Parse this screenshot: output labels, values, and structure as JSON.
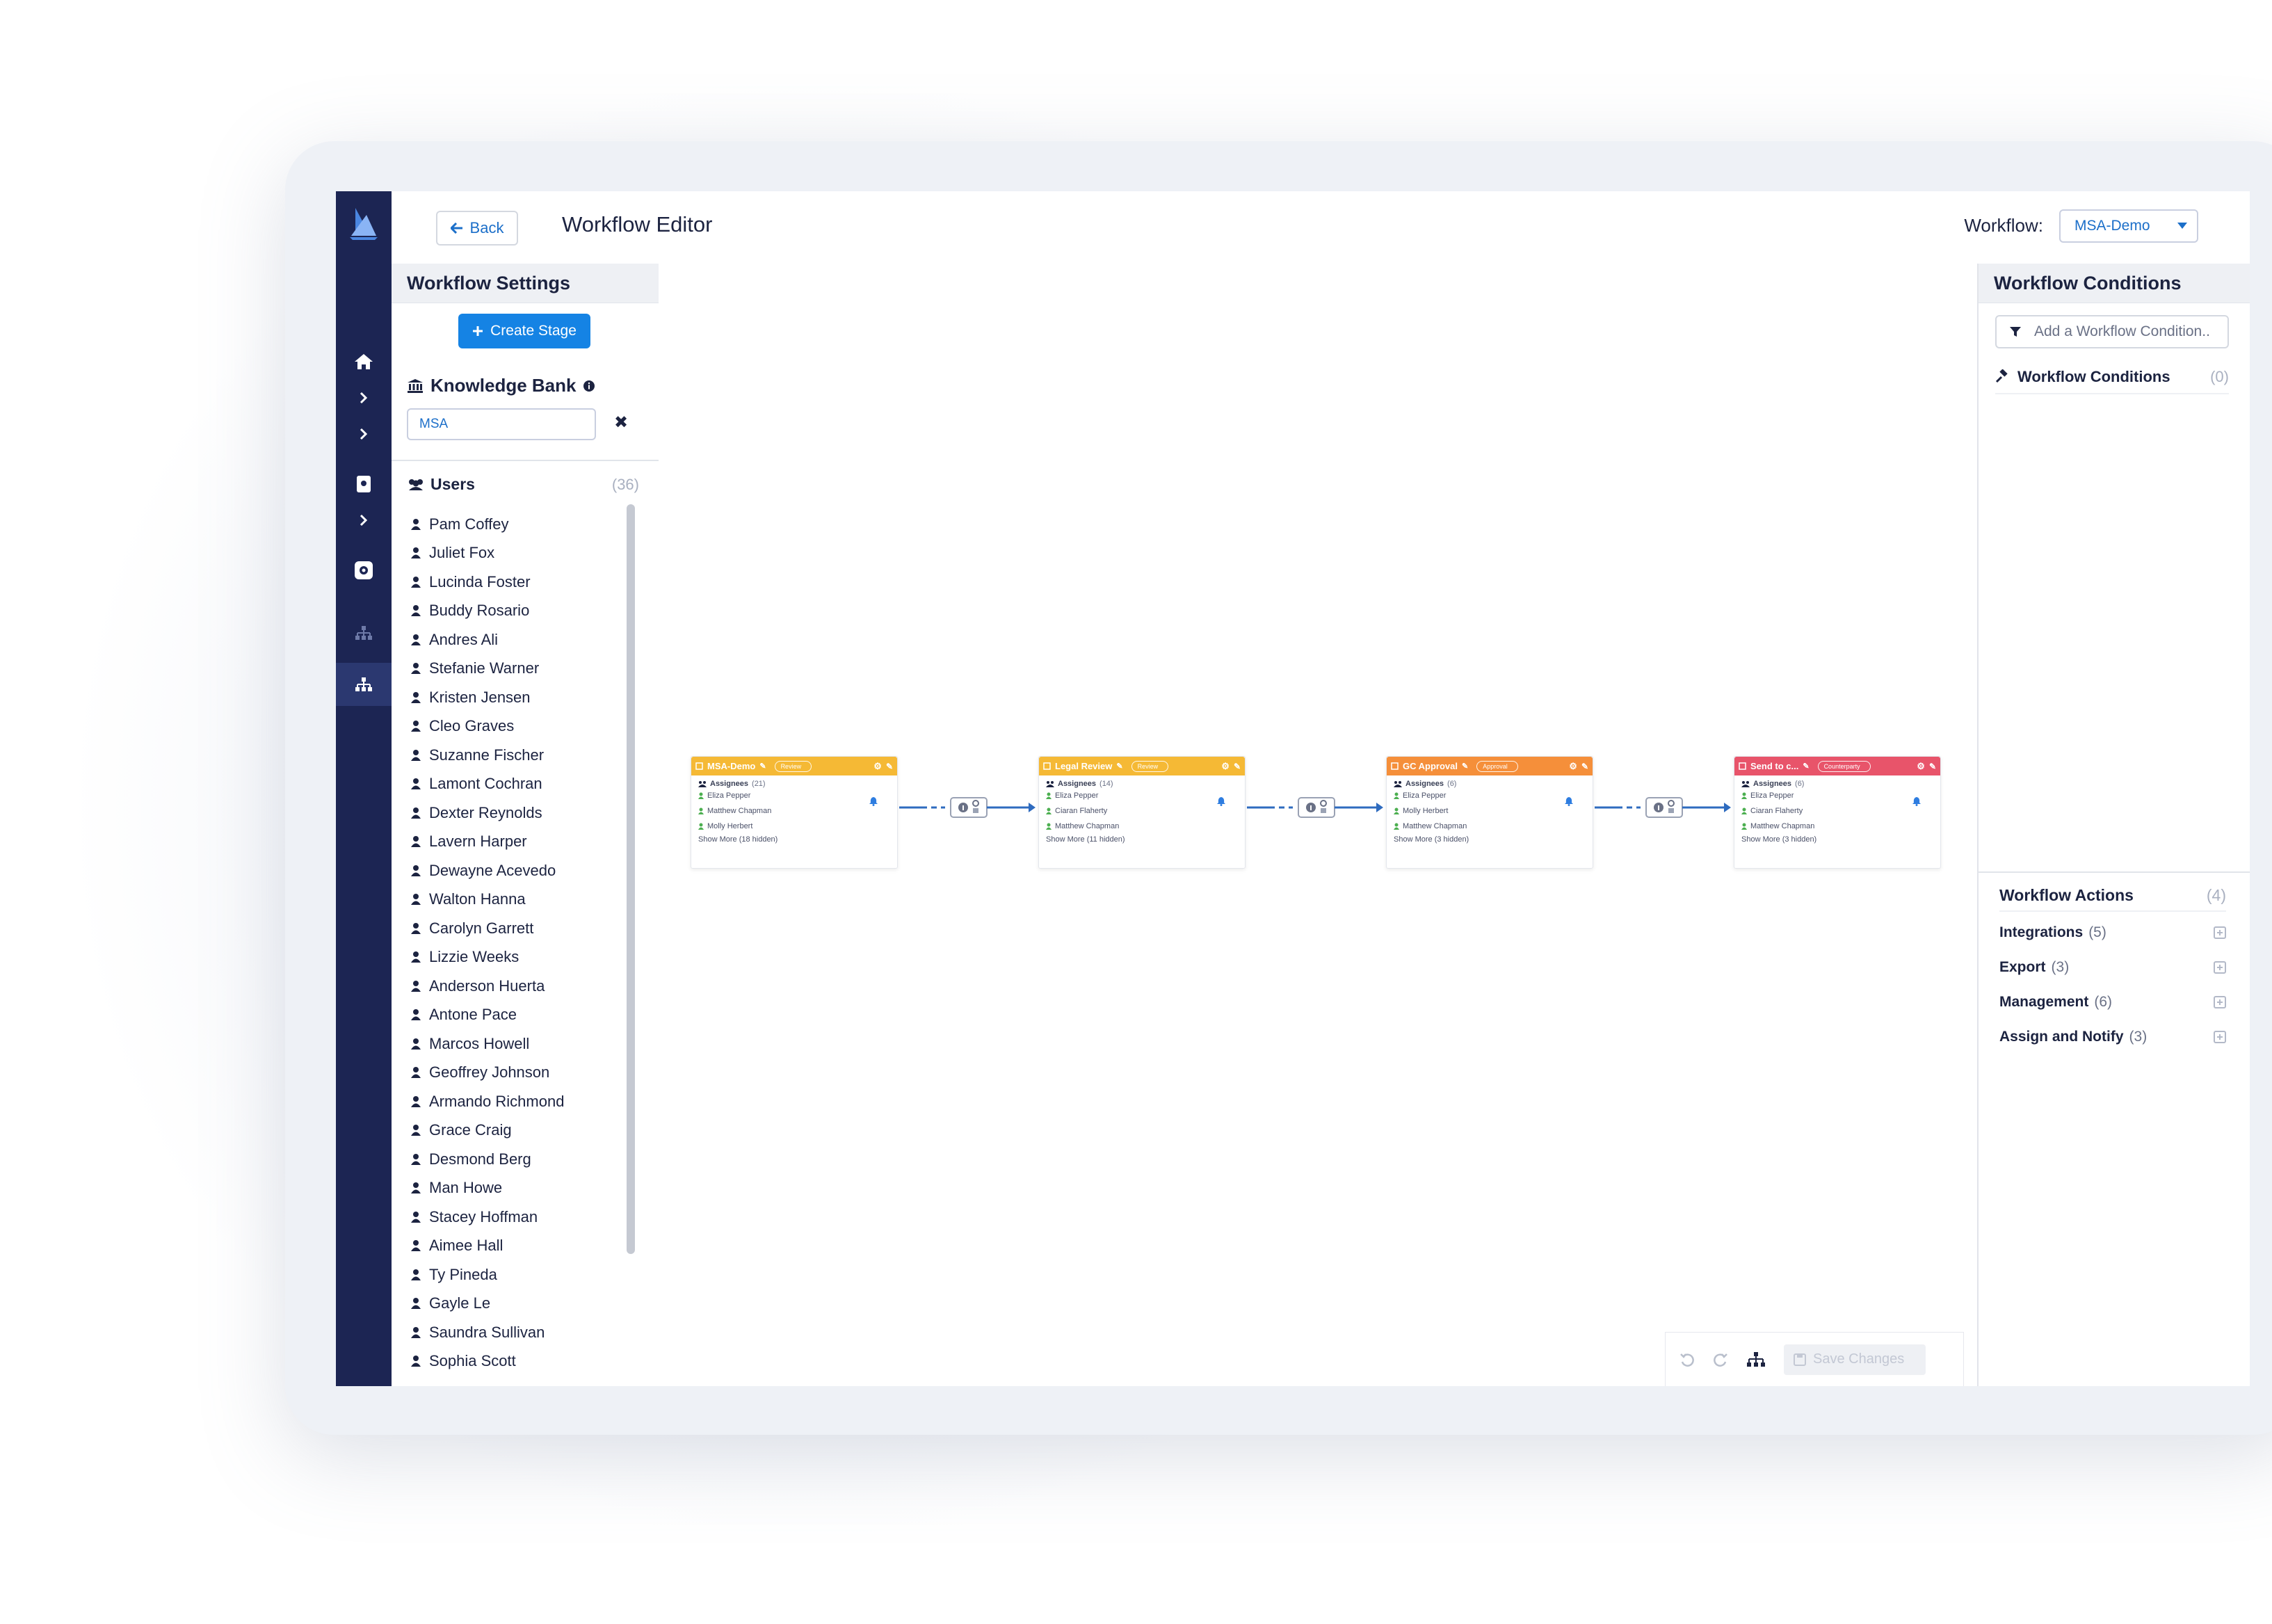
{
  "topbar": {
    "back_label": "Back",
    "title": "Workflow Editor",
    "workflow_label": "Workflow:",
    "workflow_value": "MSA-Demo"
  },
  "rail": {
    "icons": [
      "logo",
      "home-icon",
      "chevron-right-icon",
      "chevron-right-icon",
      "document-icon",
      "chevron-right-icon",
      "gear-icon",
      "workflow-icon",
      "workflow-icon"
    ]
  },
  "left_panel": {
    "title": "Workflow Settings",
    "create_stage_label": "Create Stage",
    "knowledge_bank_label": "Knowledge Bank",
    "knowledge_bank_value": "MSA",
    "users_label": "Users",
    "users_count": "(36)",
    "users": [
      "Pam Coffey",
      "Juliet Fox",
      "Lucinda Foster",
      "Buddy Rosario",
      "Andres Ali",
      "Stefanie Warner",
      "Kristen Jensen",
      "Cleo Graves",
      "Suzanne Fischer",
      "Lamont Cochran",
      "Dexter Reynolds",
      "Lavern Harper",
      "Dewayne Acevedo",
      "Walton Hanna",
      "Carolyn Garrett",
      "Lizzie Weeks",
      "Anderson Huerta",
      "Antone Pace",
      "Marcos Howell",
      "Geoffrey Johnson",
      "Armando Richmond",
      "Grace Craig",
      "Desmond Berg",
      "Man Howe",
      "Stacey Hoffman",
      "Aimee Hall",
      "Ty Pineda",
      "Gayle Le",
      "Saundra Sullivan",
      "Sophia Scott"
    ]
  },
  "right_panel": {
    "title": "Workflow Conditions",
    "add_condition_placeholder": "Add a Workflow Condition..",
    "conditions_label": "Workflow Conditions",
    "conditions_count": "(0)",
    "actions_label": "Workflow Actions",
    "actions_count": "(4)",
    "actions": [
      {
        "label": "Integrations",
        "count": "(5)"
      },
      {
        "label": "Export",
        "count": "(3)"
      },
      {
        "label": "Management",
        "count": "(6)"
      },
      {
        "label": "Assign and Notify",
        "count": "(3)"
      }
    ]
  },
  "stages": [
    {
      "title": "MSA-Demo",
      "status": "Review",
      "color": "#f5b935",
      "assignees_label": "Assignees",
      "count": "(21)",
      "people": [
        "Eliza Pepper",
        "Matthew Chapman",
        "Molly Herbert"
      ],
      "more": "Show More (18 hidden)"
    },
    {
      "title": "Legal Review",
      "status": "Review",
      "color": "#f5b935",
      "assignees_label": "Assignees",
      "count": "(14)",
      "people": [
        "Eliza Pepper",
        "Ciaran Flaherty",
        "Matthew Chapman"
      ],
      "more": "Show More (11 hidden)"
    },
    {
      "title": "GC Approval",
      "status": "Approval",
      "color": "#f58f3a",
      "assignees_label": "Assignees",
      "count": "(6)",
      "people": [
        "Eliza Pepper",
        "Molly Herbert",
        "Matthew Chapman"
      ],
      "more": "Show More (3 hidden)"
    },
    {
      "title": "Send to c...",
      "status": "Counterparty",
      "color": "#e8546a",
      "assignees_label": "Assignees",
      "count": "(6)",
      "people": [
        "Eliza Pepper",
        "Ciaran Flaherty",
        "Matthew Chapman"
      ],
      "more": "Show More (3 hidden)"
    }
  ],
  "toolbar": {
    "save_label": "Save Changes"
  },
  "colors": {
    "rail": "#1c2553",
    "accent": "#1583e4",
    "connector": "#2e6bbf"
  }
}
